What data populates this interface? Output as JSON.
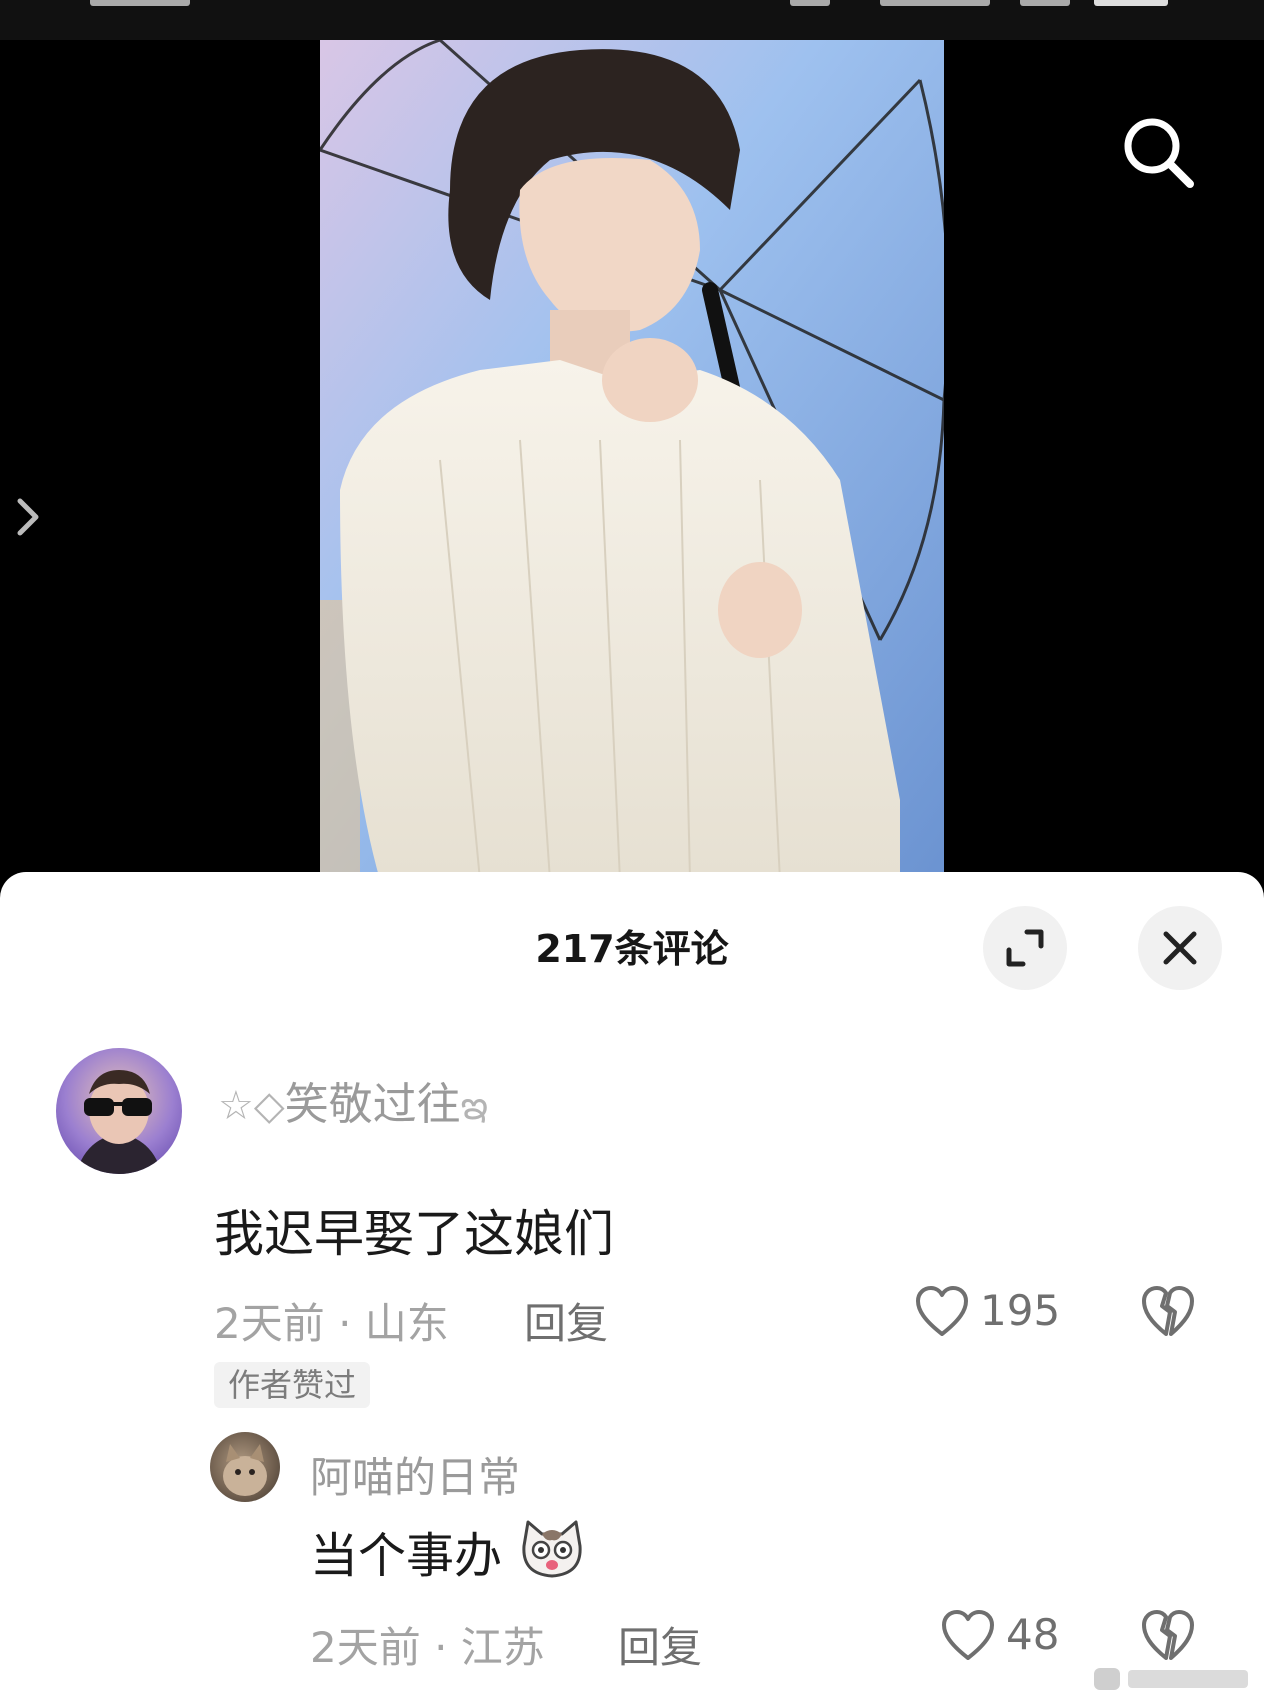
{
  "comments_header": {
    "title": "217条评论"
  },
  "comments": [
    {
      "username": "笑敬过往",
      "username_prefix": "☆◇",
      "username_suffix": "ఇ",
      "text": "我迟早娶了这娘们",
      "time": "2天前",
      "location": "山东",
      "reply_label": "回复",
      "likes": "195",
      "badge": "作者赞过",
      "replies": [
        {
          "username": "阿喵的日常",
          "text": "当个事办",
          "time": "2天前",
          "location": "江苏",
          "reply_label": "回复",
          "likes": "48"
        }
      ]
    }
  ],
  "icons": {
    "search": "search-icon",
    "expand": "expand-icon",
    "close": "close-icon",
    "like": "heart-icon",
    "dislike": "broken-heart-icon",
    "side_nav": "chevron-right-icon"
  },
  "colors": {
    "sheet_bg": "#ffffff",
    "muted_text": "#a3a3a3",
    "primary_text": "#1a1a1a"
  }
}
